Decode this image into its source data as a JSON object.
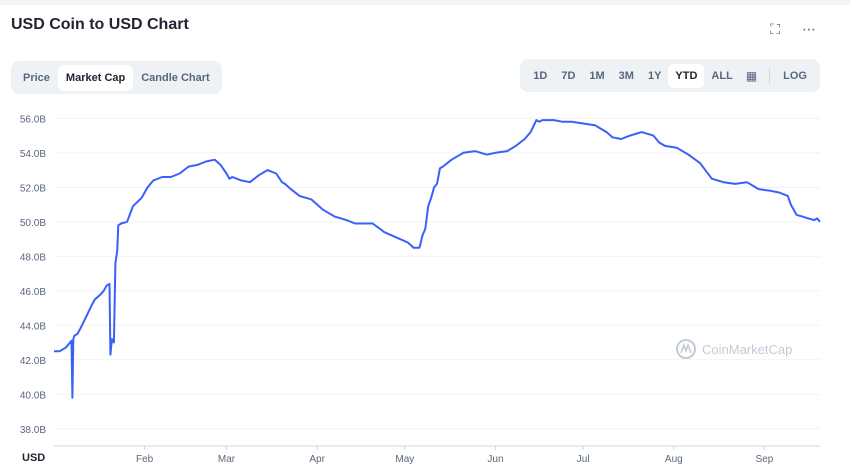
{
  "header": {
    "title": "USD Coin to USD Chart",
    "fullscreen_icon": "fullscreen-icon",
    "more_icon": "more-icon"
  },
  "tabs": [
    {
      "label": "Price",
      "active": false
    },
    {
      "label": "Market Cap",
      "active": true
    },
    {
      "label": "Candle Chart",
      "active": false
    }
  ],
  "ranges": [
    {
      "label": "1D",
      "active": false
    },
    {
      "label": "7D",
      "active": false
    },
    {
      "label": "1M",
      "active": false
    },
    {
      "label": "3M",
      "active": false
    },
    {
      "label": "1Y",
      "active": false
    },
    {
      "label": "YTD",
      "active": true
    },
    {
      "label": "ALL",
      "active": false
    }
  ],
  "calendar_icon": "calendar-icon",
  "log_label": "LOG",
  "watermark": "CoinMarketCap",
  "chart_data": {
    "type": "line",
    "title": "USD Coin to USD Chart",
    "ylabel": "",
    "xlabel": "",
    "currency_label": "USD",
    "ylim": [
      37.0,
      56.6
    ],
    "yticks": [
      "56.0B",
      "54.0B",
      "52.0B",
      "50.0B",
      "48.0B",
      "46.0B",
      "44.0B",
      "42.0B",
      "40.0B",
      "38.0B"
    ],
    "yticks_values": [
      56,
      54,
      52,
      50,
      48,
      46,
      44,
      42,
      40,
      38
    ],
    "xticks": [
      "Feb",
      "Mar",
      "Apr",
      "May",
      "Jun",
      "Jul",
      "Aug",
      "Sep"
    ],
    "xticks_day": [
      32,
      60,
      91,
      121,
      152,
      182,
      213,
      244
    ],
    "x_range_day": [
      1,
      263
    ],
    "grid": true,
    "color": "#3861fb",
    "series": [
      {
        "name": "",
        "day": [
          1,
          3,
          5,
          7,
          7.3,
          7.6,
          8,
          9,
          10,
          12,
          14,
          15,
          17,
          18,
          19,
          20,
          20.3,
          20.8,
          21.5,
          22,
          22.6,
          23,
          24,
          26,
          28,
          31,
          33,
          35,
          38,
          41,
          44,
          47,
          50,
          53,
          56,
          58,
          60,
          61,
          62,
          65,
          68,
          71,
          74,
          77,
          79,
          80,
          82,
          85,
          89,
          93,
          97,
          101,
          104,
          107,
          110,
          114,
          118,
          122,
          124,
          126,
          127,
          128,
          129,
          130,
          131,
          132,
          133,
          134,
          137,
          141,
          145,
          149,
          152,
          156,
          159,
          162,
          164,
          166,
          167,
          168,
          169,
          172,
          175,
          178,
          182,
          186,
          190,
          192,
          195,
          198,
          202,
          206,
          208,
          210,
          214,
          218,
          222,
          226,
          230,
          234,
          238,
          242,
          246,
          249,
          252,
          253,
          255,
          257,
          259,
          261,
          262,
          263
        ],
        "value": [
          42.5,
          42.5,
          42.7,
          43.1,
          39.8,
          43.2,
          43.4,
          43.5,
          43.8,
          44.5,
          45.2,
          45.5,
          45.8,
          46.0,
          46.3,
          46.4,
          42.3,
          43.2,
          43.0,
          47.6,
          48.3,
          49.8,
          49.9,
          50.0,
          50.9,
          51.4,
          52.0,
          52.4,
          52.6,
          52.6,
          52.8,
          53.2,
          53.3,
          53.5,
          53.6,
          53.3,
          52.8,
          52.5,
          52.6,
          52.4,
          52.3,
          52.7,
          53.0,
          52.8,
          52.3,
          52.2,
          51.9,
          51.5,
          51.3,
          50.7,
          50.3,
          50.1,
          49.9,
          49.9,
          49.9,
          49.4,
          49.1,
          48.8,
          48.5,
          48.5,
          49.2,
          49.6,
          50.9,
          51.4,
          52.0,
          52.2,
          53.1,
          53.2,
          53.6,
          54.0,
          54.1,
          53.9,
          54.0,
          54.1,
          54.4,
          54.8,
          55.2,
          55.9,
          55.8,
          55.9,
          55.9,
          55.9,
          55.8,
          55.8,
          55.7,
          55.6,
          55.2,
          54.9,
          54.8,
          55.0,
          55.2,
          55.0,
          54.6,
          54.4,
          54.3,
          53.9,
          53.4,
          52.5,
          52.3,
          52.2,
          52.3,
          51.9,
          51.8,
          51.7,
          51.5,
          51.0,
          50.4,
          50.3,
          50.2,
          50.1,
          50.2,
          50.0
        ]
      }
    ]
  }
}
